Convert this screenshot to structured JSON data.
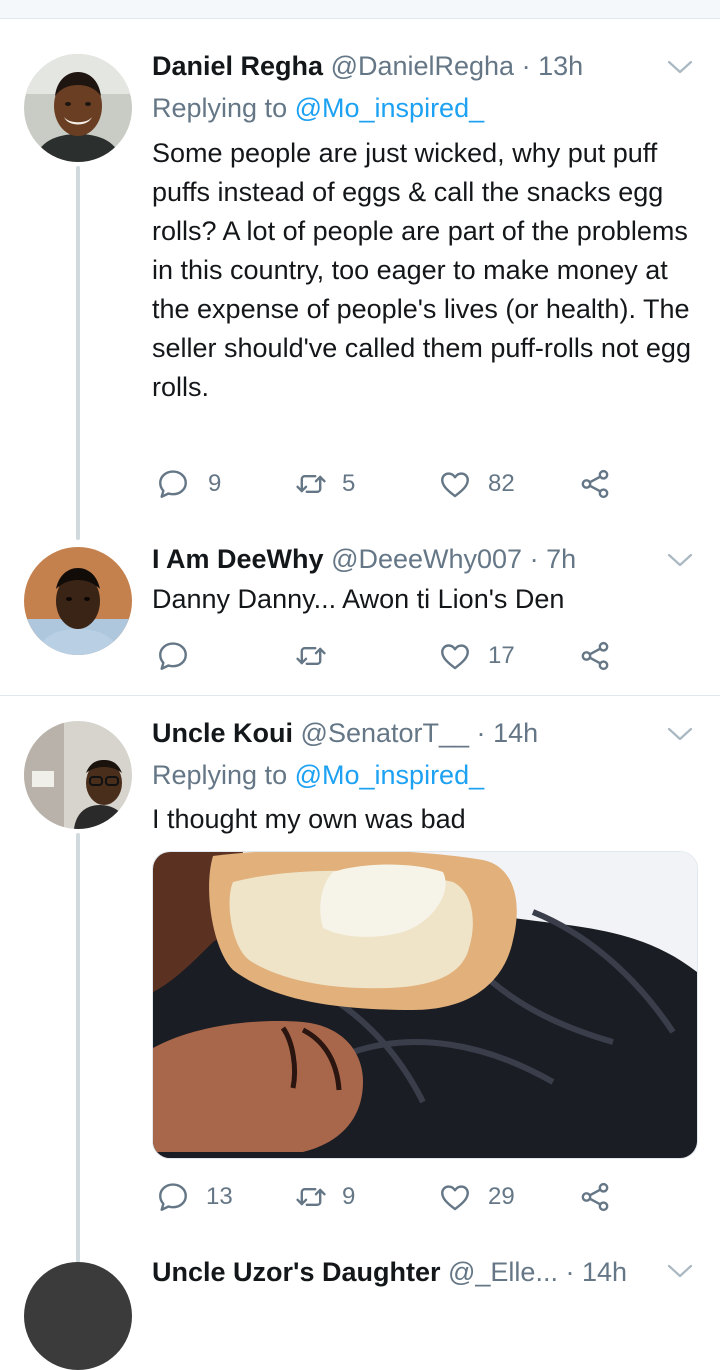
{
  "tweets": [
    {
      "name": "Daniel Regha",
      "handle": "@DanielRegha",
      "dot": "·",
      "time": "13h",
      "reply_prefix": "Replying to",
      "reply_to": "@Mo_inspired_",
      "text": "Some people are just wicked, why put puff puffs instead of eggs & call the snacks egg rolls? A lot of people are part of the problems in this country, too eager to make money at the expense of people's lives (or health). The seller should've called them puff-rolls not egg rolls.",
      "replies": "9",
      "retweets": "5",
      "likes": "82"
    },
    {
      "name": "I Am DeeWhy",
      "handle": "@DeeeWhy007",
      "dot": "·",
      "time": "7h",
      "text": "Danny Danny... Awon ti Lion's Den",
      "replies": "",
      "retweets": "",
      "likes": "17"
    },
    {
      "name": "Uncle Koui",
      "handle": "@SenatorT__",
      "dot": "·",
      "time": "14h",
      "reply_prefix": "Replying to",
      "reply_to": "@Mo_inspired_",
      "text": "I thought my own was bad",
      "replies": "13",
      "retweets": "9",
      "likes": "29"
    },
    {
      "name": "Uncle Uzor's Daughter",
      "handle": "@_Elle...",
      "dot": "·",
      "time": "14h"
    }
  ],
  "icons": {
    "reply": "reply-icon",
    "retweet": "retweet-icon",
    "like": "heart-icon",
    "share": "share-icon",
    "more": "chevron-down-icon"
  },
  "colors": {
    "link": "#1da1f2",
    "muted": "#657786",
    "line": "#cfd9de"
  }
}
